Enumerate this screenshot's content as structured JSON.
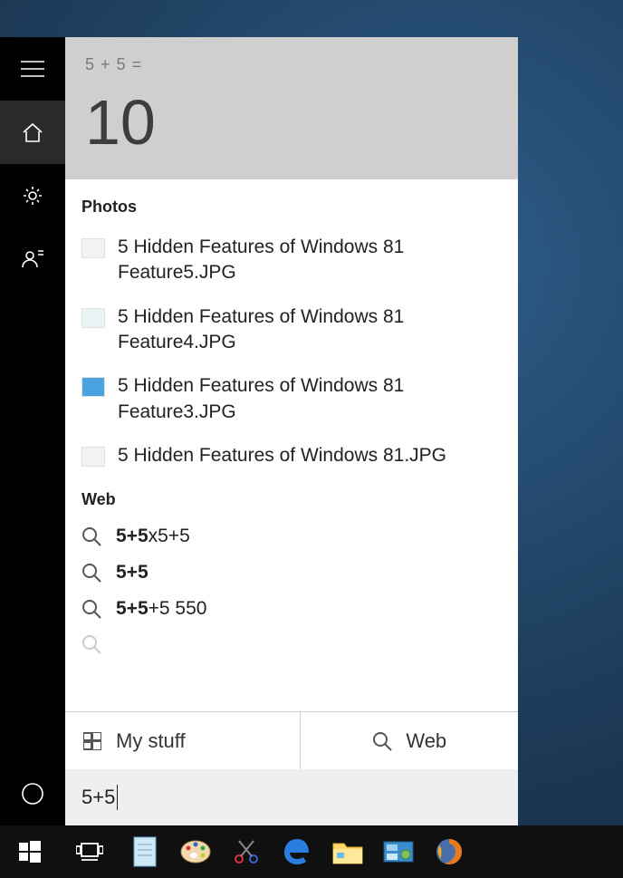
{
  "calculator": {
    "expression": "5 + 5 =",
    "answer": "10"
  },
  "sections": {
    "photos": {
      "header": "Photos",
      "items": [
        {
          "label": "5 Hidden Features of Windows 81 Feature5.JPG",
          "thumb": "light"
        },
        {
          "label": "5 Hidden Features of Windows 81 Feature4.JPG",
          "thumb": "teal"
        },
        {
          "label": "5 Hidden Features of Windows 81 Feature3.JPG",
          "thumb": "blue"
        },
        {
          "label": "5 Hidden Features of Windows 81.JPG",
          "thumb": "light"
        }
      ]
    },
    "web": {
      "header": "Web",
      "items": [
        {
          "bold": "5+5",
          "rest": "x5+5"
        },
        {
          "bold": "5+5",
          "rest": ""
        },
        {
          "bold": "5+5",
          "rest": "+5 550"
        }
      ]
    }
  },
  "filters": {
    "mystuff": "My stuff",
    "web": "Web"
  },
  "search": {
    "value": "5+5"
  },
  "rail": {
    "items": [
      "menu",
      "home",
      "settings",
      "feedback"
    ],
    "bottom": "cortana"
  },
  "taskbar": {
    "apps": [
      "start",
      "taskview",
      "notepad",
      "paint",
      "snipping-tool",
      "edge",
      "file-explorer",
      "control-panel",
      "firefox"
    ]
  }
}
